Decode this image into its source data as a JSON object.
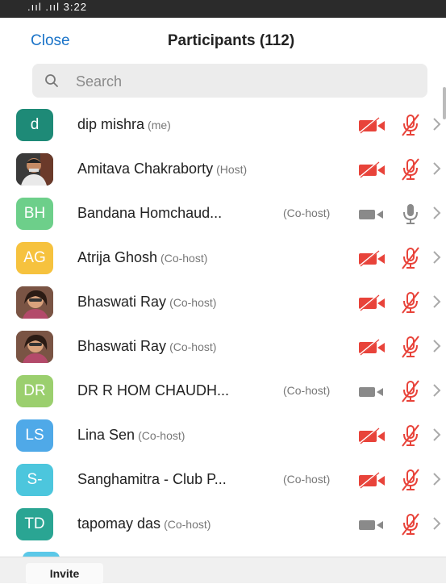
{
  "status_bar": {
    "left": ".ııl .ııl 3:22",
    "right": "📞 ⊽ 📶 🔋"
  },
  "header": {
    "close_label": "Close",
    "title": "Participants (112)"
  },
  "search": {
    "placeholder": "Search"
  },
  "participants": [
    {
      "name": "dip mishra",
      "role": "(me)",
      "avatar": "d",
      "avatar_color": "#1e8a77",
      "video": "off",
      "audio": "muted"
    },
    {
      "name": "Amitava Chakraborty",
      "role": "(Host)",
      "avatar": "",
      "avatar_color": "#3a3a3a",
      "video": "off",
      "audio": "muted"
    },
    {
      "name": "Bandana Homchaud...",
      "role": "(Co-host)",
      "avatar": "BH",
      "avatar_color": "#6dcf8a",
      "video": "on_gray",
      "audio": "unmuted"
    },
    {
      "name": "Atrija Ghosh",
      "role": "(Co-host)",
      "avatar": "AG",
      "avatar_color": "#f6c23e",
      "video": "off",
      "audio": "muted"
    },
    {
      "name": "Bhaswati Ray",
      "role": "(Co-host)",
      "avatar": "",
      "avatar_color": "#7a5444",
      "video": "off",
      "audio": "muted"
    },
    {
      "name": "Bhaswati Ray",
      "role": "(Co-host)",
      "avatar": "",
      "avatar_color": "#7a5444",
      "video": "off",
      "audio": "muted"
    },
    {
      "name": "DR R HOM CHAUDH...",
      "role": "(Co-host)",
      "avatar": "DR",
      "avatar_color": "#9bcf6e",
      "video": "on_gray",
      "audio": "muted"
    },
    {
      "name": "Lina Sen",
      "role": "(Co-host)",
      "avatar": "LS",
      "avatar_color": "#4fa9e8",
      "video": "off",
      "audio": "muted"
    },
    {
      "name": "Sanghamitra - Club P...",
      "role": "(Co-host)",
      "avatar": "S-",
      "avatar_color": "#4cc6dd",
      "video": "off",
      "audio": "muted"
    },
    {
      "name": "tapomay das",
      "role": "(Co-host)",
      "avatar": "TD",
      "avatar_color": "#2aa593",
      "video": "on_gray",
      "audio": "muted"
    }
  ],
  "footer": {
    "invite_label": "Invite"
  },
  "colors": {
    "accent": "#1a73c8",
    "muted_red": "#e8433a",
    "icon_gray": "#8a8a8a"
  }
}
